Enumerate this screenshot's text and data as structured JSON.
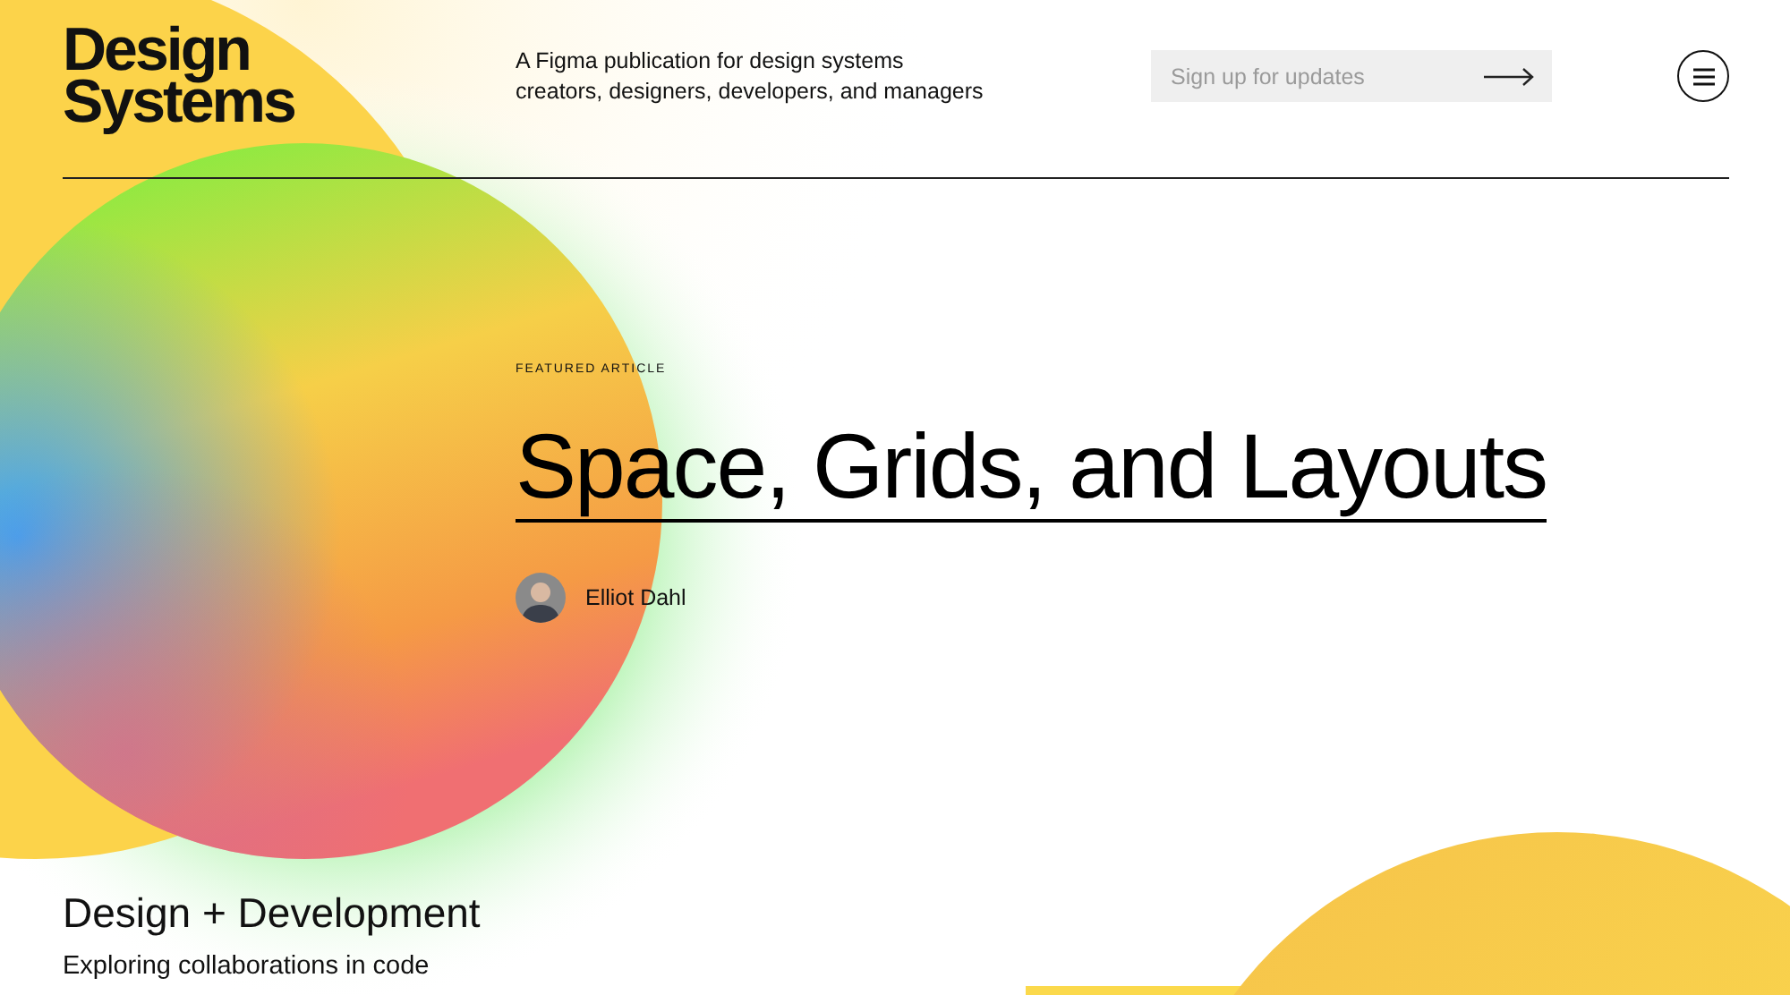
{
  "logo": {
    "lines": [
      "Design",
      "Systems"
    ]
  },
  "tagline": {
    "lines": [
      "A Figma publication for design systems",
      "creators, designers, developers, and managers"
    ]
  },
  "signup": {
    "placeholder": "Sign up for updates"
  },
  "featured": {
    "eyebrow": "FEATURED ARTICLE",
    "title": "Space, Grids, and Layouts",
    "author": "Elliot Dahl"
  },
  "section": {
    "title": "Design + Development",
    "subtitle": "Exploring collaborations in code"
  }
}
